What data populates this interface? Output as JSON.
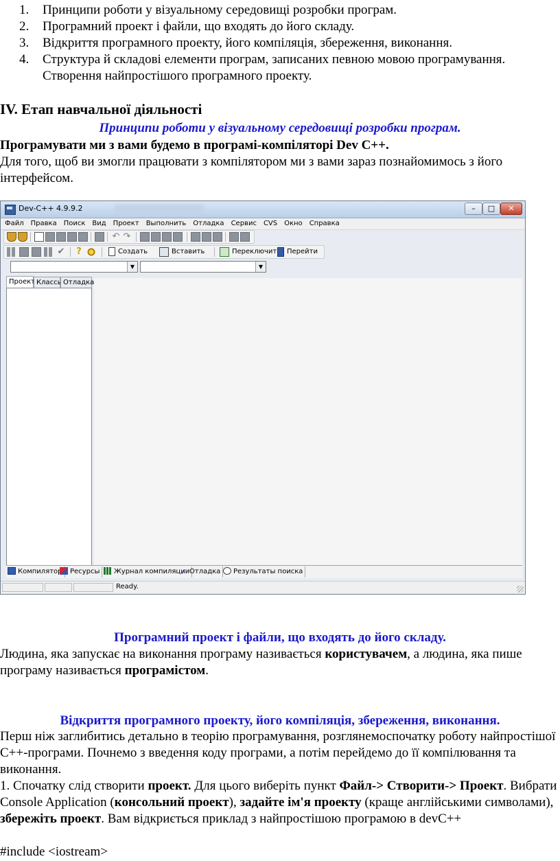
{
  "topics": [
    {
      "num": "1.",
      "text": "Принципи роботи у візуальному середовищі розробки програм."
    },
    {
      "num": "2.",
      "text": "Програмний проект і файли, що входять до його складу."
    },
    {
      "num": "3.",
      "text": "Відкриття програмного проекту, його компіляція, збереження, виконання."
    },
    {
      "num": "4.",
      "text": "Структура й складові елементи програм, записаних певною мовою програмування. Створення найпростішого програмного проекту."
    }
  ],
  "section": {
    "title": "IV. Етап навчальної діяльності",
    "subtitle": "Принципи роботи у візуальному середовищі розробки програм.",
    "bold_line": "Програмувати ми з вами будемо в програмі-компіляторі Dev C++.",
    "intro": "Для того, щоб ви змогли працювати з компілятором ми з вами зараз познайомимось з його інтерфейсом."
  },
  "devcpp": {
    "title": "Dev-C++ 4.9.9.2",
    "controls": {
      "minimize": "–",
      "maximize": "□",
      "close": "✕"
    },
    "menu": [
      "Файл",
      "Правка",
      "Поиск",
      "Вид",
      "Проект",
      "Выполнить",
      "Отладка",
      "Сервис",
      "CVS",
      "Окно",
      "Справка"
    ],
    "toolbar2_labels": {
      "create": "Создать",
      "insert": "Вставить",
      "switch": "Переключить",
      "goto": "Перейти"
    },
    "left_tabs": [
      "Проект",
      "Классы",
      "Отладка"
    ],
    "bottom_tabs": [
      "Компилятор",
      "Ресурсы",
      "Журнал компиляции",
      "Отладка",
      "Результаты поиска"
    ],
    "status": "Ready.",
    "icons": {
      "help": "?",
      "check": "✔",
      "undo": "↶",
      "redo": "↷",
      "dropdown": "▼",
      "debug_tab": "✓"
    }
  },
  "part2": {
    "heading": "Програмний проект і файли, що входять до його складу.",
    "p_start": "Людина, яка запускає на виконання програму називається ",
    "p_bold1": "користувачем",
    "p_mid": ", а людина, яка пише програму називається ",
    "p_bold2": "програмістом",
    "p_end": "."
  },
  "part3": {
    "heading": "Відкриття програмного проекту, його компіляція, збереження, виконання.",
    "p1": "Перш ніж заглибитись детально в теорію програмування, розглянемоспочатку роботу найпростішої С++-програми. Почнемо з введення коду програми, а потім перейдемо до її компілювання та виконання.",
    "s_a": "1. Спочатку слід створити ",
    "s_b": "проект.",
    "s_c": " Для цього виберіть пункт ",
    "s_d": "Файл-> Створити-> Проект",
    "s_e": ". Вибрати Console Application (",
    "s_f": "консольний проект",
    "s_g": "), ",
    "s_h": "задайте ім'я проекту",
    "s_i": " (краще англійськими символами), ",
    "s_j": "збережіть проект",
    "s_k": ". Вам відкриється приклад з найпростішою програмою в devC++",
    "code": "#include <iostream>"
  }
}
